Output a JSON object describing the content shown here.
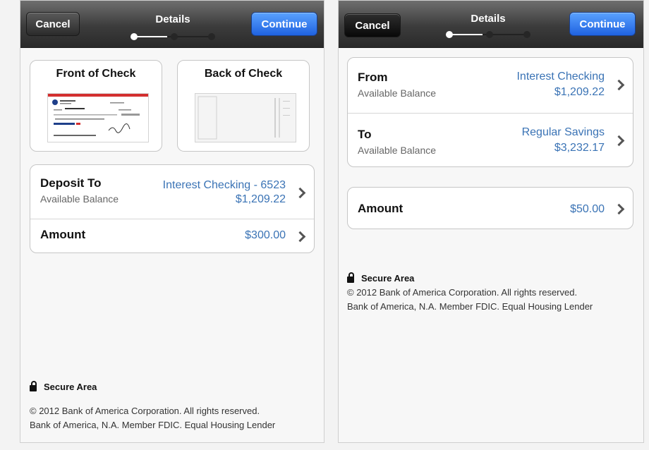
{
  "left": {
    "navbar": {
      "cancel_label": "Cancel",
      "title": "Details",
      "continue_label": "Continue",
      "progress": {
        "step": 1,
        "total": 3
      }
    },
    "check": {
      "front_label": "Front of Check",
      "back_label": "Back of Check"
    },
    "deposit": {
      "title": "Deposit To",
      "subtitle": "Available Balance",
      "account": "Interest Checking - 6523",
      "balance": "$1,209.22"
    },
    "amount": {
      "title": "Amount",
      "value": "$300.00"
    },
    "footer": {
      "secure_label": "Secure Area",
      "copyright": "© 2012  Bank of America Corporation. All rights reserved.",
      "fdic": "Bank of America, N.A. Member FDIC. Equal Housing Lender"
    }
  },
  "right": {
    "navbar": {
      "cancel_label": "Cancel",
      "title": "Details",
      "continue_label": "Continue",
      "progress": {
        "step": 1,
        "total": 3
      }
    },
    "from": {
      "title": "From",
      "subtitle": "Available Balance",
      "account": "Interest Checking",
      "balance": "$1,209.22"
    },
    "to": {
      "title": "To",
      "subtitle": "Available Balance",
      "account": "Regular Savings",
      "balance": "$3,232.17"
    },
    "amount": {
      "title": "Amount",
      "value": "$50.00"
    },
    "footer": {
      "secure_label": "Secure Area",
      "copyright": "© 2012  Bank of America Corporation. All rights reserved.",
      "fdic": "Bank of America, N.A. Member FDIC. Equal Housing Lender"
    }
  },
  "colors": {
    "accent_blue": "#3a73b5",
    "continue_button": "#2f7bf0",
    "navbar": "#3c3c3c"
  },
  "icons": [
    "lock-icon",
    "chevron-right-icon",
    "check-front-image",
    "check-back-image"
  ]
}
